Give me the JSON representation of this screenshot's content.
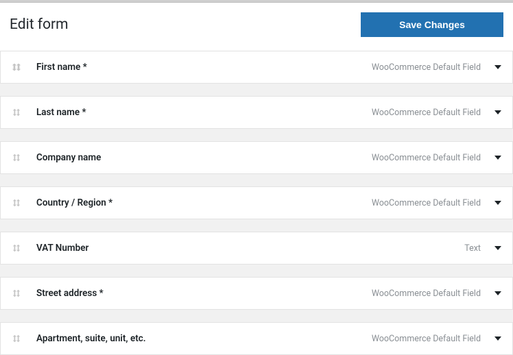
{
  "header": {
    "title": "Edit form",
    "save_label": "Save Changes"
  },
  "fields": [
    {
      "label": "First name *",
      "type": "WooCommerce Default Field"
    },
    {
      "label": "Last name *",
      "type": "WooCommerce Default Field"
    },
    {
      "label": "Company name",
      "type": "WooCommerce Default Field"
    },
    {
      "label": "Country / Region *",
      "type": "WooCommerce Default Field"
    },
    {
      "label": "VAT Number",
      "type": "Text"
    },
    {
      "label": "Street address *",
      "type": "WooCommerce Default Field"
    },
    {
      "label": "Apartment, suite, unit, etc.",
      "type": "WooCommerce Default Field"
    }
  ]
}
